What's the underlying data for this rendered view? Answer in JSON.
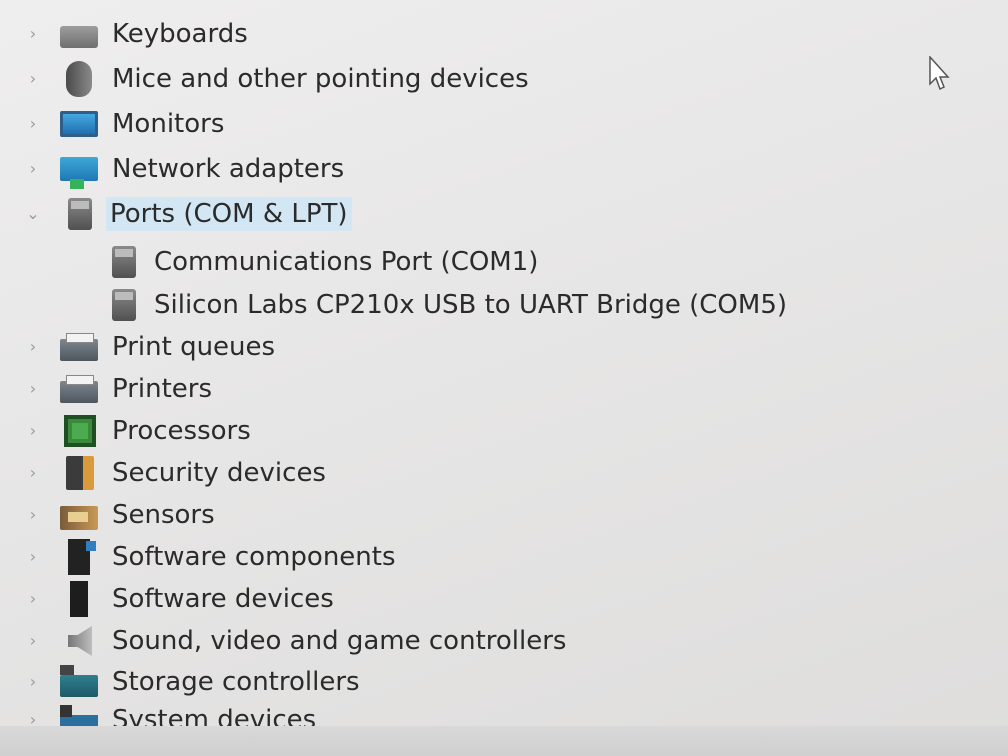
{
  "tree": {
    "items": [
      {
        "label": "Keyboards",
        "icon": "keyboard-icon",
        "expanded": false
      },
      {
        "label": "Mice and other pointing devices",
        "icon": "mouse-icon",
        "expanded": false
      },
      {
        "label": "Monitors",
        "icon": "monitor-icon",
        "expanded": false
      },
      {
        "label": "Network adapters",
        "icon": "network-adapter-icon",
        "expanded": false
      },
      {
        "label": "Ports (COM & LPT)",
        "icon": "port-icon",
        "expanded": true,
        "selected": true,
        "children": [
          {
            "label": "Communications Port (COM1)",
            "icon": "port-icon"
          },
          {
            "label": "Silicon Labs CP210x USB to UART Bridge (COM5)",
            "icon": "port-icon"
          }
        ]
      },
      {
        "label": "Print queues",
        "icon": "printer-icon",
        "expanded": false
      },
      {
        "label": "Printers",
        "icon": "printer-icon",
        "expanded": false
      },
      {
        "label": "Processors",
        "icon": "processor-icon",
        "expanded": false
      },
      {
        "label": "Security devices",
        "icon": "security-device-icon",
        "expanded": false
      },
      {
        "label": "Sensors",
        "icon": "sensor-icon",
        "expanded": false
      },
      {
        "label": "Software components",
        "icon": "software-component-icon",
        "expanded": false
      },
      {
        "label": "Software devices",
        "icon": "software-device-icon",
        "expanded": false
      },
      {
        "label": "Sound, video and game controllers",
        "icon": "speaker-icon",
        "expanded": false
      },
      {
        "label": "Storage controllers",
        "icon": "storage-controller-icon",
        "expanded": false
      },
      {
        "label": "System devices",
        "icon": "system-device-icon",
        "expanded": false
      }
    ]
  },
  "colors": {
    "selection": "#d2e6f4",
    "text": "#2b2b2b",
    "chevron": "#9a9a9a"
  },
  "glyphs": {
    "collapsed": "›",
    "expanded": "⌄"
  }
}
